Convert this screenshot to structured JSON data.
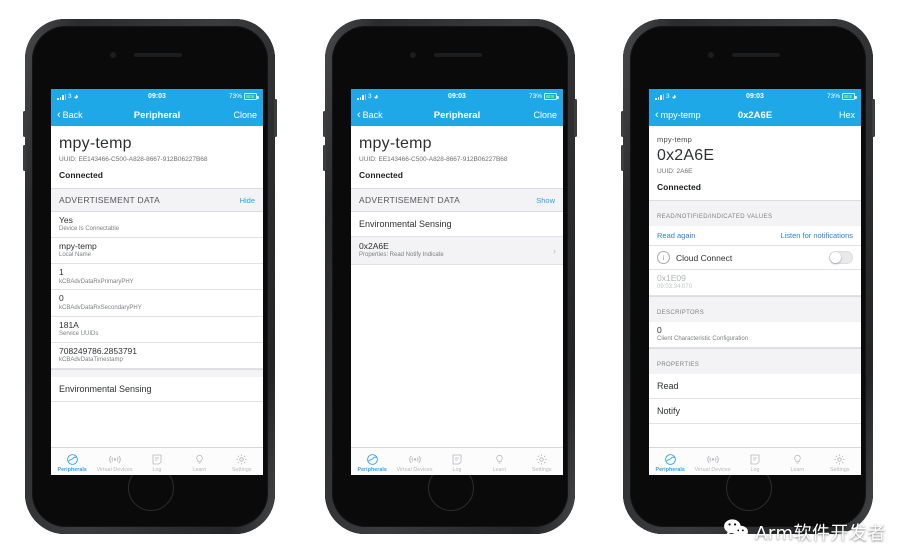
{
  "status_bar": {
    "carrier": "3",
    "time": "09:03",
    "battery_percent": "73%",
    "signal_icon": "signal-bars-icon",
    "wifi_icon": "wifi-icon",
    "battery_icon": "battery-charging-icon"
  },
  "colors": {
    "nav_blue": "#1fa8e8",
    "link_blue": "#2f9fe0",
    "accent_link": "#2f7fd0",
    "section_bg": "#f3f3f5"
  },
  "tab_bar": {
    "items": [
      {
        "label": "Peripherals",
        "icon": "peripherals-icon",
        "active": true
      },
      {
        "label": "Virtual Devices",
        "icon": "broadcast-icon",
        "active": false
      },
      {
        "label": "Log",
        "icon": "log-icon",
        "active": false
      },
      {
        "label": "Learn",
        "icon": "lightbulb-icon",
        "active": false
      },
      {
        "label": "Settings",
        "icon": "gear-icon",
        "active": false
      }
    ]
  },
  "phone1": {
    "nav": {
      "back": "Back",
      "title": "Peripheral",
      "right": "Clone"
    },
    "device_name": "mpy-temp",
    "device_uuid": "UUID: EE143466-C500-A828-8667-912B06227B68",
    "connection_state": "Connected",
    "advertisement": {
      "header": "ADVERTISEMENT DATA",
      "action": "Hide",
      "rows": [
        {
          "value": "Yes",
          "sub": "Device Is Connectable"
        },
        {
          "value": "mpy-temp",
          "sub": "Local Name"
        },
        {
          "value": "1",
          "sub": "kCBAdvDataRxPrimaryPHY"
        },
        {
          "value": "0",
          "sub": "kCBAdvDataRxSecondaryPHY"
        },
        {
          "value": "181A",
          "sub": "Service UUIDs"
        },
        {
          "value": "708249786.2853791",
          "sub": "kCBAdvDataTimestamp"
        }
      ]
    },
    "service_row": "Environmental Sensing"
  },
  "phone2": {
    "nav": {
      "back": "Back",
      "title": "Peripheral",
      "right": "Clone"
    },
    "device_name": "mpy-temp",
    "device_uuid": "UUID: EE143466-C500-A828-8667-912B06227B68",
    "connection_state": "Connected",
    "advertisement": {
      "header": "ADVERTISEMENT DATA",
      "action": "Show"
    },
    "service_row": "Environmental Sensing",
    "characteristic": {
      "value": "0x2A6E",
      "sub": "Properties: Read Notify Indicate",
      "chevron": "chevron-right-icon"
    }
  },
  "phone3": {
    "nav": {
      "back": "mpy-temp",
      "title": "0x2A6E",
      "right": "Hex"
    },
    "parent_device": "mpy-temp",
    "characteristic_name": "0x2A6E",
    "characteristic_uuid": "UUID: 2A6E",
    "connection_state": "Connected",
    "values_section": {
      "header": "READ/NOTIFIED/INDICATED VALUES",
      "read_again": "Read again",
      "listen": "Listen for notifications",
      "cloud_connect_label": "Cloud Connect",
      "cloud_connect_on": false,
      "value": "0x1E09",
      "timestamp": "09:03:34.070"
    },
    "descriptors_section": {
      "header": "DESCRIPTORS",
      "rows": [
        {
          "value": "0",
          "sub": "Client Characteristic Configuration"
        }
      ]
    },
    "properties_section": {
      "header": "PROPERTIES",
      "rows": [
        "Read",
        "Notify"
      ]
    }
  },
  "watermark": {
    "icon": "wechat-icon",
    "text": "Arm软件开发者"
  }
}
